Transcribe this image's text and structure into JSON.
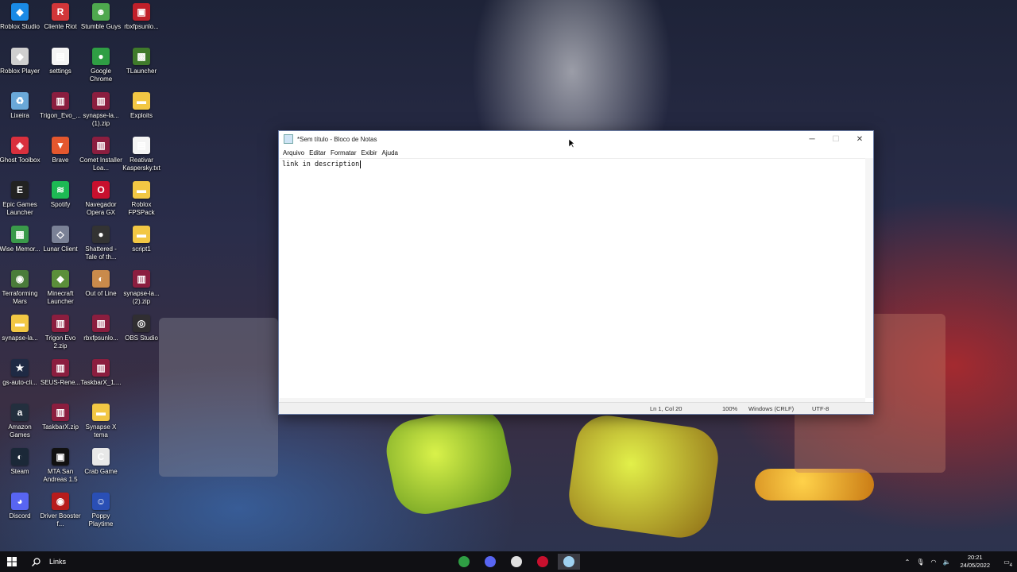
{
  "desktop_icons": [
    {
      "label": "Roblox Studio",
      "glyph": "◆",
      "color": "#1a8ae6"
    },
    {
      "label": "Cliente Riot",
      "glyph": "R",
      "color": "#d13639"
    },
    {
      "label": "Stumble Guys",
      "glyph": "☻",
      "color": "#4ea84e"
    },
    {
      "label": "rbxfpsunlo...",
      "glyph": "▣",
      "color": "#c0202a"
    },
    {
      "label": "Roblox Player",
      "glyph": "◆",
      "color": "#cfcfcf"
    },
    {
      "label": "settings",
      "glyph": "▤",
      "color": "#f4f4f4"
    },
    {
      "label": "Google Chrome",
      "glyph": "●",
      "color": "#2f9e44"
    },
    {
      "label": "TLauncher",
      "glyph": "▩",
      "color": "#3f7a2b"
    },
    {
      "label": "Lixeira",
      "glyph": "♻",
      "color": "#6aa8d8"
    },
    {
      "label": "Trigon_Evo_...",
      "glyph": "▥",
      "color": "#8b1e3f"
    },
    {
      "label": "synapse-la... (1).zip",
      "glyph": "▥",
      "color": "#8b1e3f"
    },
    {
      "label": "Exploits",
      "glyph": "▬",
      "color": "#f2c744"
    },
    {
      "label": "Ghost Toolbox",
      "glyph": "◈",
      "color": "#d9303d"
    },
    {
      "label": "Brave",
      "glyph": "▼",
      "color": "#e4572e"
    },
    {
      "label": "Comet Installer Loa...",
      "glyph": "▥",
      "color": "#8b1e3f"
    },
    {
      "label": "Reativar Kaspersky.txt",
      "glyph": "▤",
      "color": "#f4f4f4"
    },
    {
      "label": "Epic Games Launcher",
      "glyph": "E",
      "color": "#222222"
    },
    {
      "label": "Spotify",
      "glyph": "≋",
      "color": "#1db954"
    },
    {
      "label": "Navegador Opera GX",
      "glyph": "O",
      "color": "#c8102e"
    },
    {
      "label": "Roblox FPSPack",
      "glyph": "▬",
      "color": "#f2c744"
    },
    {
      "label": "Wise Memor...",
      "glyph": "▦",
      "color": "#3a9a4a"
    },
    {
      "label": "Lunar Client",
      "glyph": "◇",
      "color": "#7a8196"
    },
    {
      "label": "Shattered - Tale of th...",
      "glyph": "●",
      "color": "#333333"
    },
    {
      "label": "script1",
      "glyph": "▬",
      "color": "#f2c744"
    },
    {
      "label": "Terraforming Mars",
      "glyph": "◉",
      "color": "#4a7c3a"
    },
    {
      "label": "Minecraft Launcher",
      "glyph": "◆",
      "color": "#5b8f3a"
    },
    {
      "label": "Out of Line",
      "glyph": "◐",
      "color": "#c98a4b"
    },
    {
      "label": "synapse-la... (2).zip",
      "glyph": "▥",
      "color": "#8b1e3f"
    },
    {
      "label": "synapse-la...",
      "glyph": "▬",
      "color": "#f2c744"
    },
    {
      "label": "Trigon Evo 2.zip",
      "glyph": "▥",
      "color": "#8b1e3f"
    },
    {
      "label": "rbxfpsunlo...",
      "glyph": "▥",
      "color": "#8b1e3f"
    },
    {
      "label": "OBS Studio",
      "glyph": "◎",
      "color": "#302e31"
    },
    {
      "label": "gs-auto-cli...",
      "glyph": "★",
      "color": "#1f2a44"
    },
    {
      "label": "SEUS-Rene...",
      "glyph": "▥",
      "color": "#8b1e3f"
    },
    {
      "label": "TaskbarX_1....",
      "glyph": "▥",
      "color": "#8b1e3f"
    },
    {
      "label": "",
      "glyph": "",
      "color": ""
    },
    {
      "label": "Amazon Games",
      "glyph": "a",
      "color": "#232f3e"
    },
    {
      "label": "TaskbarX.zip",
      "glyph": "▥",
      "color": "#8b1e3f"
    },
    {
      "label": "Synapse X tema",
      "glyph": "▬",
      "color": "#f2c744"
    },
    {
      "label": "",
      "glyph": "",
      "color": ""
    },
    {
      "label": "Steam",
      "glyph": "◐",
      "color": "#1b2838"
    },
    {
      "label": "MTA San Andreas 1.5",
      "glyph": "▣",
      "color": "#111111"
    },
    {
      "label": "Crab Game",
      "glyph": "C",
      "color": "#e8e8e8"
    },
    {
      "label": "",
      "glyph": "",
      "color": ""
    },
    {
      "label": "Discord",
      "glyph": "◕",
      "color": "#5865f2"
    },
    {
      "label": "Driver Booster f...",
      "glyph": "◉",
      "color": "#b71c1c"
    },
    {
      "label": "Poppy Playtime",
      "glyph": "☺",
      "color": "#2a4fb5"
    }
  ],
  "notepad": {
    "title": "*Sem título - Bloco de Notas",
    "menu": [
      "Arquivo",
      "Editar",
      "Formatar",
      "Exibir",
      "Ajuda"
    ],
    "content": "link in description",
    "status": {
      "position": "Ln 1, Col 20",
      "zoom": "100%",
      "line_ending": "Windows (CRLF)",
      "encoding": "UTF-8"
    }
  },
  "taskbar": {
    "search_text": "Links",
    "pinned": [
      {
        "name": "chrome-taskbar-icon",
        "color": "#2f9e44"
      },
      {
        "name": "obs-taskbar-icon",
        "color": "#5865f2"
      },
      {
        "name": "synapse-taskbar-icon",
        "color": "#e0e0e0"
      },
      {
        "name": "opera-taskbar-icon",
        "color": "#c8102e"
      },
      {
        "name": "notepad-taskbar-icon",
        "color": "#9fd1f0"
      }
    ],
    "clock_time": "20:21",
    "clock_date": "24/05/2022",
    "notification_count": "4"
  }
}
